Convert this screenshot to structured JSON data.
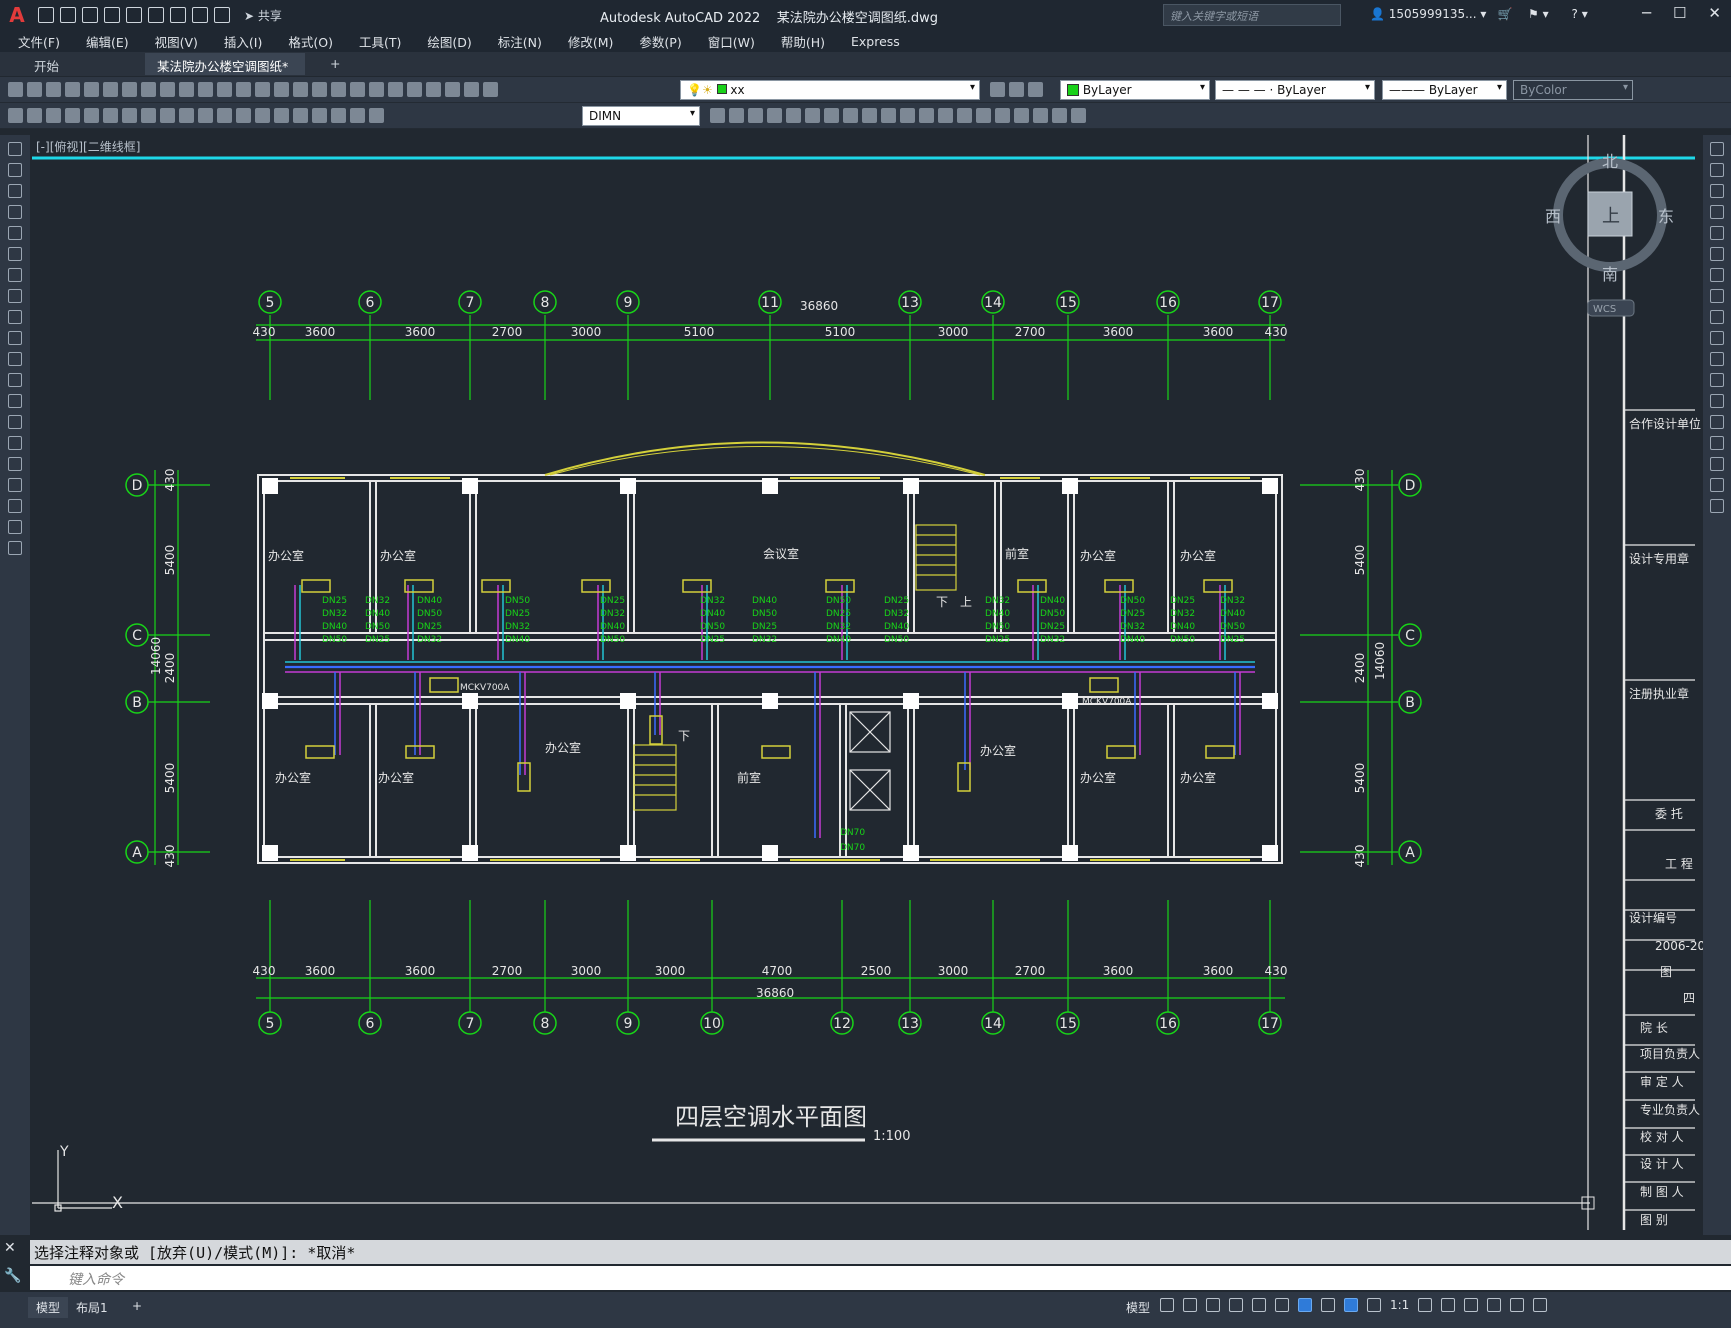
{
  "window": {
    "app_title": "Autodesk AutoCAD 2022",
    "file_title": "某法院办公楼空调图纸.dwg",
    "share_label": "共享",
    "search_placeholder": "键入关键字或短语",
    "user": "1505999135...",
    "logo": "A"
  },
  "menu": [
    "文件(F)",
    "编辑(E)",
    "视图(V)",
    "插入(I)",
    "格式(O)",
    "工具(T)",
    "绘图(D)",
    "标注(N)",
    "修改(M)",
    "参数(P)",
    "窗口(W)",
    "帮助(H)",
    "Express"
  ],
  "tabs": {
    "start": "开始",
    "active": "某法院办公楼空调图纸*",
    "add": "+"
  },
  "layers": {
    "current_layer": "xx",
    "color": "ByLayer",
    "linetype": "ByLayer",
    "lineweight": "ByLayer",
    "plotstyle": "ByColor",
    "dimstyle": "DIMN"
  },
  "viewport": {
    "label": "[-][俯视][二维线框]",
    "compass": {
      "north": "北",
      "south": "南",
      "west": "西",
      "east": "东",
      "top": "上",
      "wcs": "WCS"
    },
    "ucs": {
      "y": "Y",
      "x": "X"
    }
  },
  "drawing": {
    "title": "四层空调水平面图",
    "scale": "1:100",
    "col_axes": [
      "5",
      "6",
      "7",
      "8",
      "9",
      "11",
      "13",
      "14",
      "15",
      "16",
      "17"
    ],
    "col_axes_bottom": [
      "5",
      "6",
      "7",
      "8",
      "9",
      "10",
      "12",
      "13",
      "14",
      "15",
      "16",
      "17"
    ],
    "row_axes": [
      "D",
      "C",
      "B",
      "A"
    ],
    "total_dim": "36860",
    "top_dims": [
      "430",
      "3600",
      "3600",
      "2700",
      "3000",
      "5100",
      "5100",
      "3000",
      "2700",
      "3600",
      "3600",
      "430"
    ],
    "bottom_dims": [
      "430",
      "3600",
      "3600",
      "2700",
      "3000",
      "3000",
      "4700",
      "2500",
      "3000",
      "2700",
      "3600",
      "3600",
      "430"
    ],
    "side_dims": [
      "430",
      "5400",
      "2400",
      "5400",
      "430"
    ],
    "side_total": "14060",
    "rooms": {
      "office": "办公室",
      "meeting": "会议室",
      "anteroom": "前室",
      "up": "上",
      "down": "下"
    },
    "equipment": [
      "MCKV700A",
      "MCKV700A"
    ],
    "pipe_labels": [
      "DN25",
      "DN32",
      "DN40",
      "DN50",
      "DN70"
    ]
  },
  "titleblock": {
    "rows": [
      "合作设计单位",
      "设计专用章",
      "注册执业章",
      "委 托",
      "工 程",
      "设计编号",
      "2006-20",
      "图",
      "四",
      "院 长",
      "项目负责人",
      "审 定 人",
      "专业负责人",
      "校 对 人",
      "设 计 人",
      "制 图 人",
      "图 别"
    ]
  },
  "command": {
    "history": "选择注释对象或 [放弃(U)/模式(M)]: *取消*",
    "placeholder": "键入命令"
  },
  "status": {
    "model_tab": "模型",
    "layout_tab": "布局1",
    "model_label": "模型",
    "scale": "1:1"
  },
  "colors": {
    "background": "#212830",
    "grid_green": "#18d418",
    "wall": "#e6e6e6",
    "window_yellow": "#d4d03a",
    "pipe_blue": "#3a6cff",
    "pipe_magenta": "#c43ad4",
    "pipe_cyan": "#22c4d4"
  }
}
